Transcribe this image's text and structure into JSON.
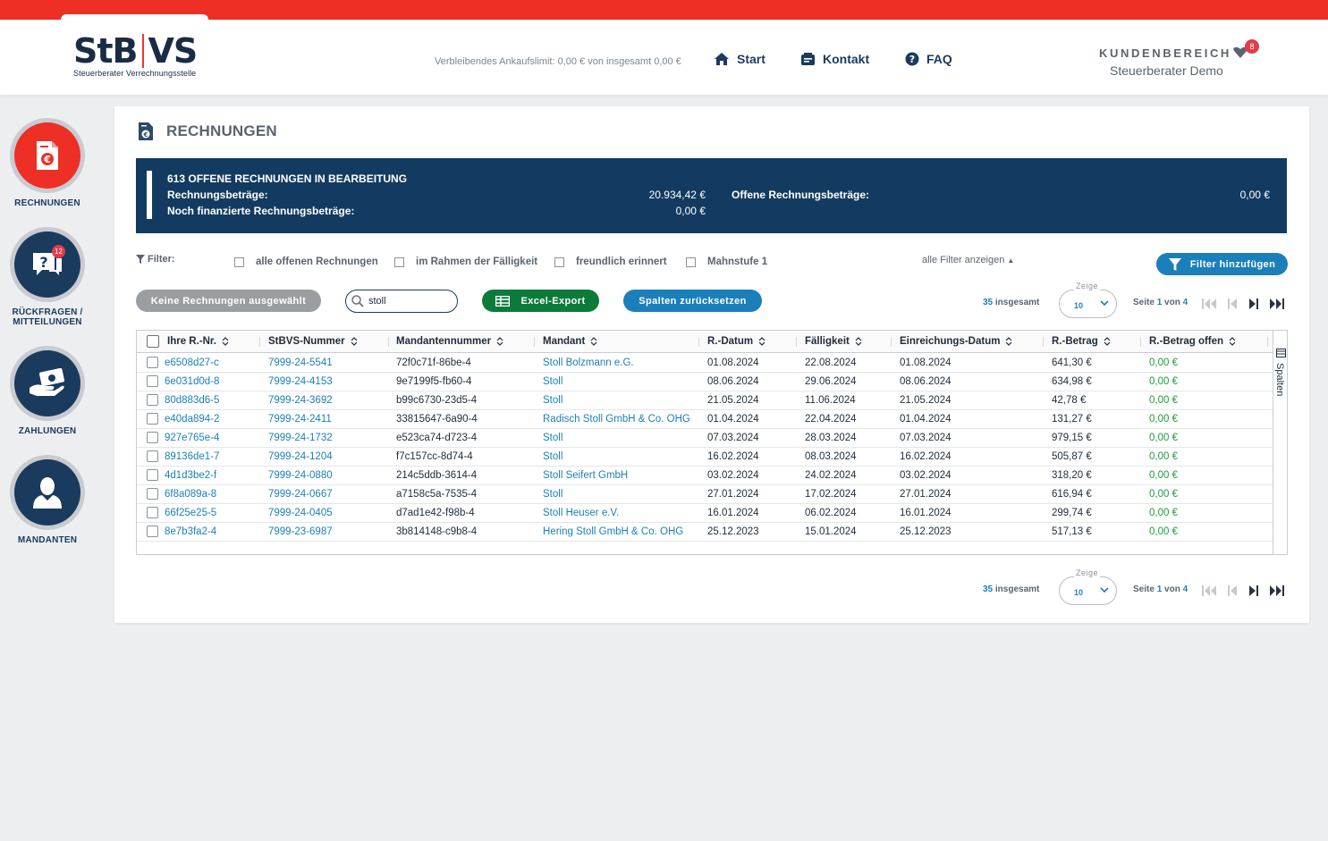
{
  "header": {
    "logo_main_left": "StB",
    "logo_main_right": "VS",
    "logo_sub": "Steuerberater Verrechnungsstelle",
    "limit_text": "Verbleibendes Ankaufslimit: 0,00 € von insgesamt 0,00 €",
    "nav": {
      "start": "Start",
      "kontakt": "Kontakt",
      "faq": "FAQ"
    },
    "kundenbereich": "KUNDENBEREICH",
    "user": "Steuerberater Demo",
    "notification_count": "8"
  },
  "sidebar": {
    "items": [
      {
        "label": "RECHNUNGEN",
        "icon": "invoice-euro-icon",
        "active": true
      },
      {
        "label": "RÜCKFRAGEN / MITTEILUNGEN",
        "icon": "question-chat-icon",
        "badge": "12"
      },
      {
        "label": "ZAHLUNGEN",
        "icon": "payment-hand-icon"
      },
      {
        "label": "MANDANTEN",
        "icon": "user-icon"
      }
    ]
  },
  "page": {
    "title": "RECHNUNGEN",
    "summary": {
      "headline": "613 OFFENE RECHNUNGEN IN BEARBEITUNG",
      "rechnungsbetraege_label": "Rechnungsbeträge:",
      "rechnungsbetraege_value": "20.934,42 €",
      "noch_label": "Noch finanzierte Rechnungsbeträge:",
      "noch_value": "0,00 €",
      "offene_label": "Offene Rechnungsbeträge:",
      "offene_value": "0,00 €"
    },
    "filter": {
      "label": "Filter:",
      "options": [
        "alle offenen Rechnungen",
        "im Rahmen der Fälligkeit",
        "freundlich erinnert",
        "Mahnstufe 1"
      ],
      "show_all": "alle Filter anzeigen",
      "add_button": "Filter hinzufügen"
    },
    "actions": {
      "none_selected": "Keine Rechnungen ausgewählt",
      "search_value": "stoll",
      "excel": "Excel-Export",
      "reset_columns": "Spalten zurücksetzen"
    },
    "pagination": {
      "total_count": "35",
      "total_label": "insgesamt",
      "zeige_label": "Zeige",
      "page_size": "10",
      "seite_label": "Seite",
      "current_page": "1",
      "von_label": "von",
      "total_pages": "4"
    },
    "table": {
      "columns": [
        "Ihre R.-Nr.",
        "StBVS-Nummer",
        "Mandantennummer",
        "Mandant",
        "R.-Datum",
        "Fälligkeit",
        "Einreichungs-Datum",
        "R.-Betrag",
        "R.-Betrag offen"
      ],
      "side_label": "Spalten",
      "rows": [
        [
          "e6508d27-c",
          "7999-24-5541",
          "72f0c71f-86be-4",
          "Stoll Bolzmann e.G.",
          "01.08.2024",
          "22.08.2024",
          "01.08.2024",
          "641,30 €",
          "0,00 €"
        ],
        [
          "6e031d0d-8",
          "7999-24-4153",
          "9e7199f5-fb60-4",
          "Stoll",
          "08.06.2024",
          "29.06.2024",
          "08.06.2024",
          "634,98 €",
          "0,00 €"
        ],
        [
          "80d883d6-5",
          "7999-24-3692",
          "b99c6730-23d5-4",
          "Stoll",
          "21.05.2024",
          "11.06.2024",
          "21.05.2024",
          "42,78 €",
          "0,00 €"
        ],
        [
          "e40da894-2",
          "7999-24-2411",
          "33815647-6a90-4",
          "Radisch Stoll GmbH & Co. OHG",
          "01.04.2024",
          "22.04.2024",
          "01.04.2024",
          "131,27 €",
          "0,00 €"
        ],
        [
          "927e765e-4",
          "7999-24-1732",
          "e523ca74-d723-4",
          "Stoll",
          "07.03.2024",
          "28.03.2024",
          "07.03.2024",
          "979,15 €",
          "0,00 €"
        ],
        [
          "89136de1-7",
          "7999-24-1204",
          "f7c157cc-8d74-4",
          "Stoll",
          "16.02.2024",
          "08.03.2024",
          "16.02.2024",
          "505,87 €",
          "0,00 €"
        ],
        [
          "4d1d3be2-f",
          "7999-24-0880",
          "214c5ddb-3614-4",
          "Stoll Seifert GmbH",
          "03.02.2024",
          "24.02.2024",
          "03.02.2024",
          "318,20 €",
          "0,00 €"
        ],
        [
          "6f8a089a-8",
          "7999-24-0667",
          "a7158c5a-7535-4",
          "Stoll",
          "27.01.2024",
          "17.02.2024",
          "27.01.2024",
          "616,94 €",
          "0,00 €"
        ],
        [
          "66f25e25-5",
          "7999-24-0405",
          "d7ad1e42-f98b-4",
          "Stoll Heuser e.V.",
          "16.01.2024",
          "06.02.2024",
          "16.01.2024",
          "299,74 €",
          "0,00 €"
        ],
        [
          "8e7b3fa2-4",
          "7999-23-6987",
          "3b814148-c9b8-4",
          "Hering Stoll GmbH & Co. OHG",
          "25.12.2023",
          "15.01.2024",
          "25.12.2023",
          "517,13 €",
          "0,00 €"
        ]
      ]
    }
  },
  "colors": {
    "brand_red": "#ee2f25",
    "navy": "#133b61",
    "link_blue": "#1b7fb9",
    "excel_green": "#0c7a3b",
    "open_green": "#1e9e3a"
  }
}
